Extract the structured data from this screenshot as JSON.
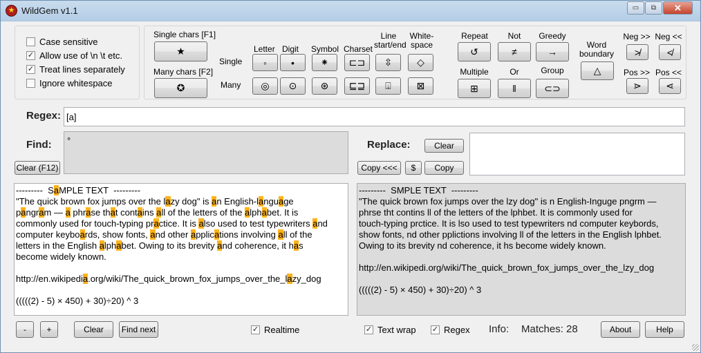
{
  "window": {
    "title": "WildGem v1.1",
    "minimize": "▭",
    "restore": "⧉",
    "close": "✕"
  },
  "options": [
    {
      "label": "Case sensitive",
      "checked": false
    },
    {
      "label": "Allow use of \\n \\t etc.",
      "checked": true
    },
    {
      "label": "Treat lines separately",
      "checked": true
    },
    {
      "label": "Ignore whitespace",
      "checked": false
    }
  ],
  "chars": {
    "single_label": "Single chars [F1]",
    "single_glyph": "★",
    "many_label": "Many chars [F2]",
    "many_glyph": "✪"
  },
  "classes": {
    "row_single": "Single",
    "row_many": "Many",
    "cols": [
      {
        "label": "Letter",
        "single": "◦",
        "many": "◎"
      },
      {
        "label": "Digit",
        "single": "•",
        "many": "⊙"
      },
      {
        "label": "Symbol",
        "single": "⁕",
        "many": "⊛"
      },
      {
        "label": "Charset",
        "single": "⊏⊐",
        "many": "⊑⊒"
      },
      {
        "label": "Line\nstart/end",
        "single": "⇳",
        "many": "⍗"
      },
      {
        "label": "White-\nspace",
        "single": "◇",
        "many": "⊠"
      }
    ]
  },
  "ops": {
    "repeat": {
      "label": "Repeat",
      "glyph": "↺"
    },
    "not": {
      "label": "Not",
      "glyph": "≠"
    },
    "greedy": {
      "label": "Greedy",
      "glyph": "→"
    },
    "multiple": {
      "label": "Multiple",
      "glyph": "⊞"
    },
    "or": {
      "label": "Or",
      "glyph": "‖"
    },
    "group": {
      "label": "Group",
      "glyph": "⊂⊃"
    },
    "word_boundary": {
      "label": "Word\nboundary",
      "glyph": "△"
    },
    "neg_ahead": {
      "label": "Neg >>",
      "glyph": "≯"
    },
    "neg_behind": {
      "label": "Neg <<",
      "glyph": "≮"
    },
    "pos_ahead": {
      "label": "Pos >>",
      "glyph": "⋗"
    },
    "pos_behind": {
      "label": "Pos <<",
      "glyph": "⋖"
    }
  },
  "regex": {
    "label": "Regex:",
    "value": "[a]"
  },
  "find": {
    "label": "Find:",
    "value": "°",
    "clear": "Clear (F12)"
  },
  "replace": {
    "label": "Replace:",
    "clear": "Clear",
    "copy_left": "Copy <<<",
    "dollar": "$",
    "copy": "Copy",
    "value": ""
  },
  "source_text": [
    "---------  S[a]MPLE TEXT  ---------",
    "\"The quick brown fox jumps over the l[a]zy dog\" is [a]n English-l[a]ngu[a]ge",
    "p[a]ngr[a]m — [a] phr[a]se th[a]t cont[a]ins [a]ll of the letters of the [a]lph[a]bet. It is",
    "commonly used for touch-typing pr[a]ctice. It is [a]lso used to test typewriters [a]nd",
    "computer keybo[a]rds, show fonts, [a]nd other [a]pplic[a]tions involving [a]ll of the",
    "letters in the English [a]lph[a]bet. Owing to its brevity [a]nd coherence, it h[a]s",
    "become widely known.",
    "",
    "http://en.wikipedi[a].org/wiki/The_quick_brown_fox_jumps_over_the_l[a]zy_dog",
    "",
    "(((((2) - 5) × 450) + 30)÷20) ^ 3"
  ],
  "result_text": [
    "---------  SMPLE TEXT  ---------",
    "\"The quick brown fox jumps over the lzy dog\" is n English-Inguge pngrm —",
    "phrse tht contins ll of the letters of the lphbet. It is commonly used for",
    "touch-typing prctice. It is lso used to test typewriters nd computer keybords,",
    "show fonts, nd other pplictions involving ll of the letters in the English lphbet.",
    "Owing to its brevity nd coherence, it hs become widely known.",
    "",
    "http://en.wikipedi.org/wiki/The_quick_brown_fox_jumps_over_the_lzy_dog",
    "",
    "(((((2) - 5) × 450) + 30)÷20) ^ 3"
  ],
  "bottom": {
    "minus": "-",
    "plus": "+",
    "clear": "Clear",
    "find_next": "Find next",
    "realtime": {
      "label": "Realtime",
      "checked": true
    },
    "text_wrap": {
      "label": "Text wrap",
      "checked": true
    },
    "regex_opt": {
      "label": "Regex",
      "checked": true
    },
    "info_label": "Info:",
    "matches": "Matches: 28",
    "about": "About",
    "help": "Help"
  }
}
